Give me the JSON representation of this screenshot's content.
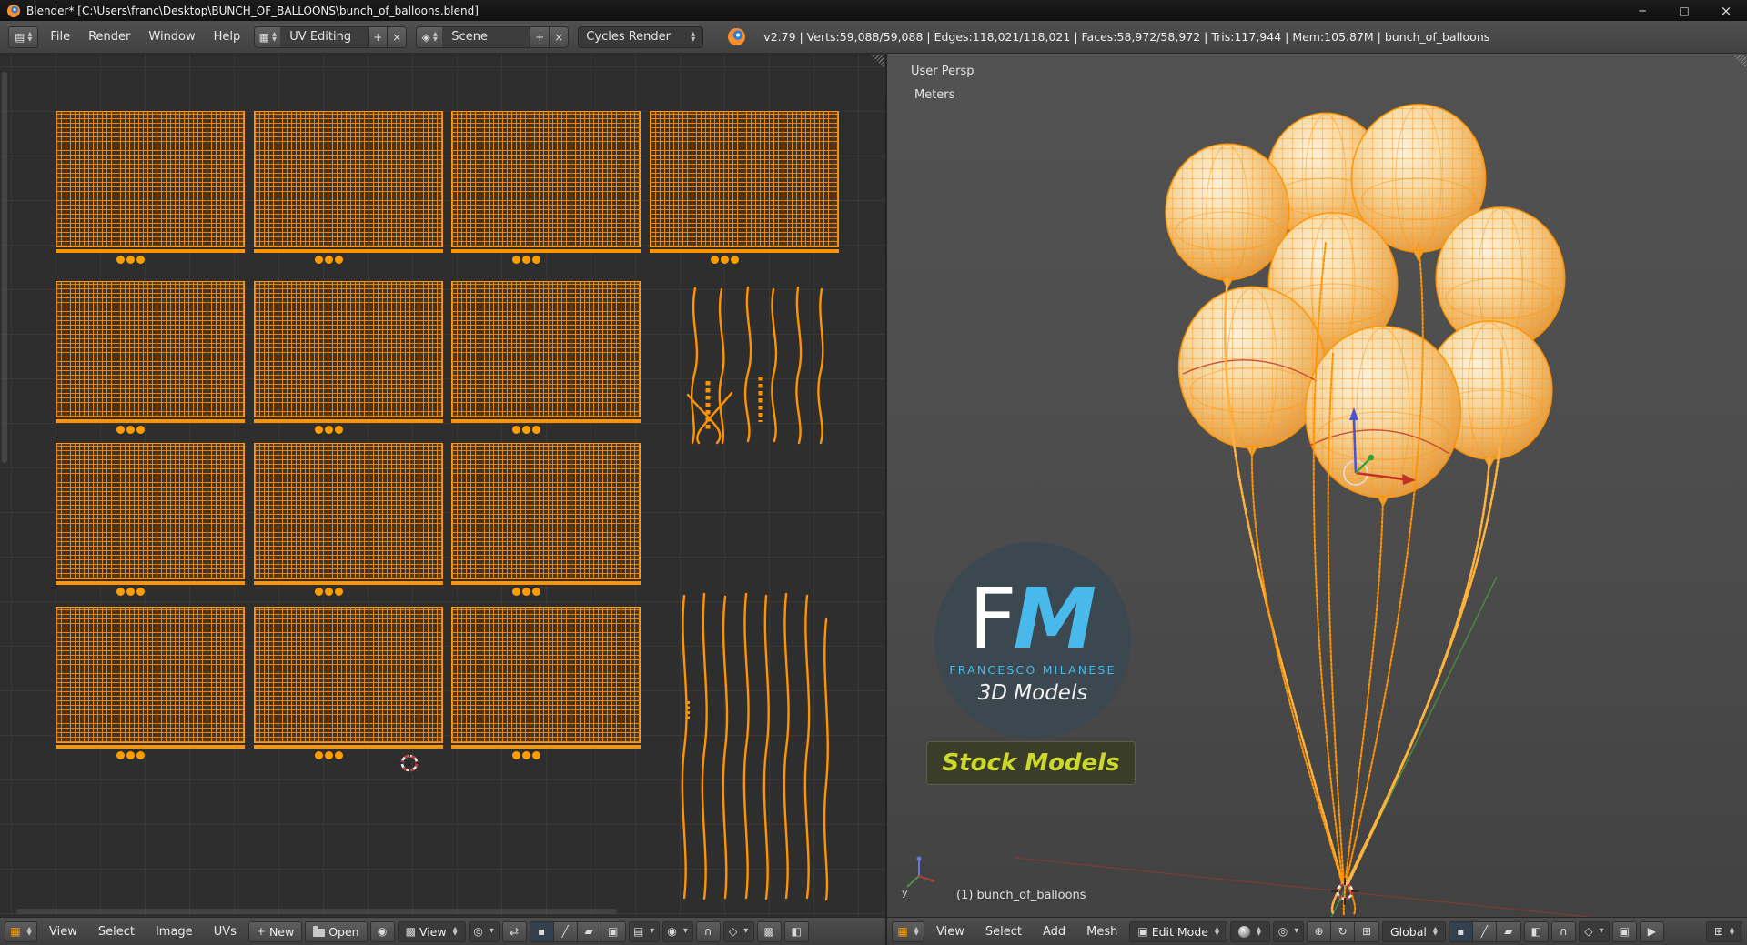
{
  "window": {
    "title": "Blender* [C:\\Users\\franc\\Desktop\\BUNCH_OF_BALLOONS\\bunch_of_balloons.blend]"
  },
  "icons": {
    "minimize": "─",
    "maximize": "□",
    "close": "×",
    "arrow_up": "▲",
    "arrow_down": "▼",
    "arrow_down_single": "▼",
    "editor_info": "▤",
    "editor_uv": "▦",
    "editor_3d": "▦",
    "layout_browse": "▦",
    "scene_browse": "◈",
    "plus": "+",
    "delete_x": "×",
    "image": "▩",
    "pin": "◉",
    "pivot": "◎",
    "sync": "⇄",
    "vertex_mode": "▪",
    "edge_mode": "╱",
    "face_mode": "▰",
    "island_mode": "▣",
    "sticky": "▤",
    "proportional": "◉",
    "magnet": "∩",
    "snap_element": "◇",
    "normalize": "▩",
    "occlude": "◧",
    "cube": "▣",
    "manip_translate": "⊕",
    "manip_rotate": "↻",
    "manip_scale": "⊞",
    "render_ogl": "▣",
    "render_anim": "▶",
    "editor_corner": "⊞"
  },
  "topbar": {
    "menus": [
      "File",
      "Render",
      "Window",
      "Help"
    ],
    "layout": {
      "value": "UV Editing"
    },
    "scene": {
      "value": "Scene"
    },
    "engine": {
      "value": "Cycles Render"
    },
    "stats": "v2.79 | Verts:59,088/59,088 | Edges:118,021/118,021 | Faces:58,972/58,972 | Tris:117,944 | Mem:105.87M | bunch_of_balloons"
  },
  "uv_editor": {
    "footer": {
      "menus": [
        "View",
        "Select",
        "Image",
        "UVs"
      ],
      "new_button": "New",
      "open_button": "Open",
      "display_dropdown": "View"
    }
  },
  "viewport": {
    "view_label": "User Persp",
    "units_label": "Meters",
    "object_label": "(1) bunch_of_balloons",
    "axis_label": "y",
    "watermark": {
      "initial_f": "F",
      "initial_m": "M",
      "name": "FRANCESCO MILANESE",
      "tagline": "3D Models",
      "badge": "Stock Models"
    },
    "footer": {
      "menus": [
        "View",
        "Select",
        "Add",
        "Mesh"
      ],
      "mode": "Edit Mode",
      "orientation": "Global"
    }
  }
}
